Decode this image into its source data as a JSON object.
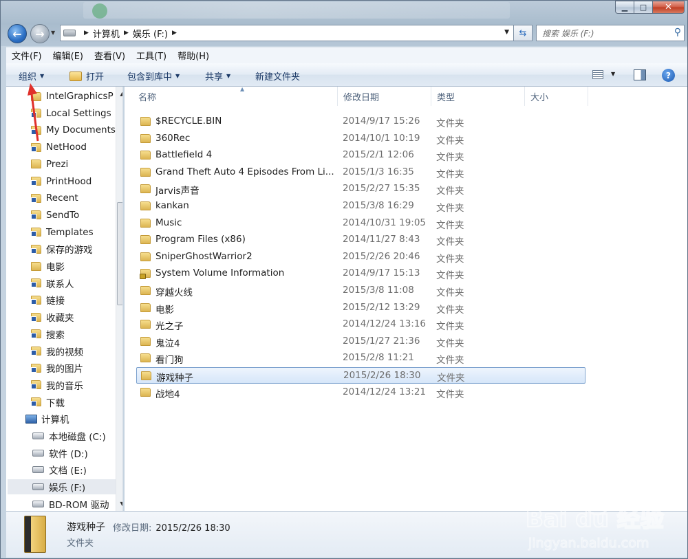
{
  "window": {
    "caption": {
      "minimize": "▁",
      "maximize": "□",
      "close": "✕"
    },
    "accent": "#1a58b0"
  },
  "nav": {
    "breadcrumbs": [
      "计算机",
      "娱乐 (F:)"
    ],
    "search_placeholder": "搜索 娱乐 (F:)"
  },
  "menubar": [
    "文件(F)",
    "编辑(E)",
    "查看(V)",
    "工具(T)",
    "帮助(H)"
  ],
  "toolbar": {
    "organize": "组织",
    "open": "打开",
    "include_library": "包含到库中",
    "share": "共享",
    "new_folder": "新建文件夹"
  },
  "sidebar": {
    "items": [
      {
        "label": "IntelGraphicsP",
        "icon": "folder-icon"
      },
      {
        "label": "Local Settings",
        "icon": "folder-shortcut-icon"
      },
      {
        "label": "My Documents",
        "icon": "folder-shortcut-icon"
      },
      {
        "label": "NetHood",
        "icon": "folder-shortcut-icon"
      },
      {
        "label": "Prezi",
        "icon": "folder-icon"
      },
      {
        "label": "PrintHood",
        "icon": "folder-shortcut-icon"
      },
      {
        "label": "Recent",
        "icon": "recent-icon"
      },
      {
        "label": "SendTo",
        "icon": "folder-shortcut-icon"
      },
      {
        "label": "Templates",
        "icon": "folder-shortcut-icon"
      },
      {
        "label": "保存的游戏",
        "icon": "saved-games-icon"
      },
      {
        "label": "电影",
        "icon": "folder-icon"
      },
      {
        "label": "联系人",
        "icon": "contacts-icon"
      },
      {
        "label": "链接",
        "icon": "links-icon"
      },
      {
        "label": "收藏夹",
        "icon": "favorites-icon"
      },
      {
        "label": "搜索",
        "icon": "searches-icon"
      },
      {
        "label": "我的视频",
        "icon": "videos-icon"
      },
      {
        "label": "我的图片",
        "icon": "pictures-icon"
      },
      {
        "label": "我的音乐",
        "icon": "music-icon"
      },
      {
        "label": "下载",
        "icon": "downloads-icon"
      },
      {
        "label": "计算机",
        "icon": "computer-icon"
      },
      {
        "label": "本地磁盘 (C:)",
        "icon": "drive-icon"
      },
      {
        "label": "软件 (D:)",
        "icon": "drive-icon"
      },
      {
        "label": "文档 (E:)",
        "icon": "drive-icon"
      },
      {
        "label": "娱乐 (F:)",
        "icon": "drive-icon"
      },
      {
        "label": "BD-ROM 驱动",
        "icon": "optical-drive-icon"
      }
    ]
  },
  "columns": {
    "name": "名称",
    "date": "修改日期",
    "type": "类型",
    "size": "大小"
  },
  "files": [
    {
      "name": "$RECYCLE.BIN",
      "date": "2014/9/17 15:26",
      "type": "文件夹"
    },
    {
      "name": "360Rec",
      "date": "2014/10/1 10:19",
      "type": "文件夹"
    },
    {
      "name": "Battlefield 4",
      "date": "2015/2/1 12:06",
      "type": "文件夹"
    },
    {
      "name": "Grand Theft Auto 4 Episodes From Li...",
      "date": "2015/1/3 16:35",
      "type": "文件夹"
    },
    {
      "name": "Jarvis声音",
      "date": "2015/2/27 15:35",
      "type": "文件夹"
    },
    {
      "name": "kankan",
      "date": "2015/3/8 16:29",
      "type": "文件夹"
    },
    {
      "name": "Music",
      "date": "2014/10/31 19:05",
      "type": "文件夹"
    },
    {
      "name": "Program Files (x86)",
      "date": "2014/11/27 8:43",
      "type": "文件夹"
    },
    {
      "name": "SniperGhostWarrior2",
      "date": "2015/2/26 20:46",
      "type": "文件夹"
    },
    {
      "name": "System Volume Information",
      "date": "2014/9/17 15:13",
      "type": "文件夹",
      "locked": true
    },
    {
      "name": "穿越火线",
      "date": "2015/3/8 11:08",
      "type": "文件夹"
    },
    {
      "name": "电影",
      "date": "2015/2/12 13:29",
      "type": "文件夹"
    },
    {
      "name": "光之子",
      "date": "2014/12/24 13:16",
      "type": "文件夹"
    },
    {
      "name": "鬼泣4",
      "date": "2015/1/27 21:36",
      "type": "文件夹"
    },
    {
      "name": "看门狗",
      "date": "2015/2/8 11:21",
      "type": "文件夹"
    },
    {
      "name": "游戏种子",
      "date": "2015/2/26 18:30",
      "type": "文件夹",
      "selected": true
    },
    {
      "name": "战地4",
      "date": "2014/12/24 13:21",
      "type": "文件夹"
    }
  ],
  "details": {
    "name": "游戏种子",
    "meta_label": "修改日期:",
    "meta_value": "2015/2/26 18:30",
    "type": "文件夹"
  },
  "watermark": {
    "brand": "Bai du 经验",
    "url": "jingyan.baidu.com"
  }
}
